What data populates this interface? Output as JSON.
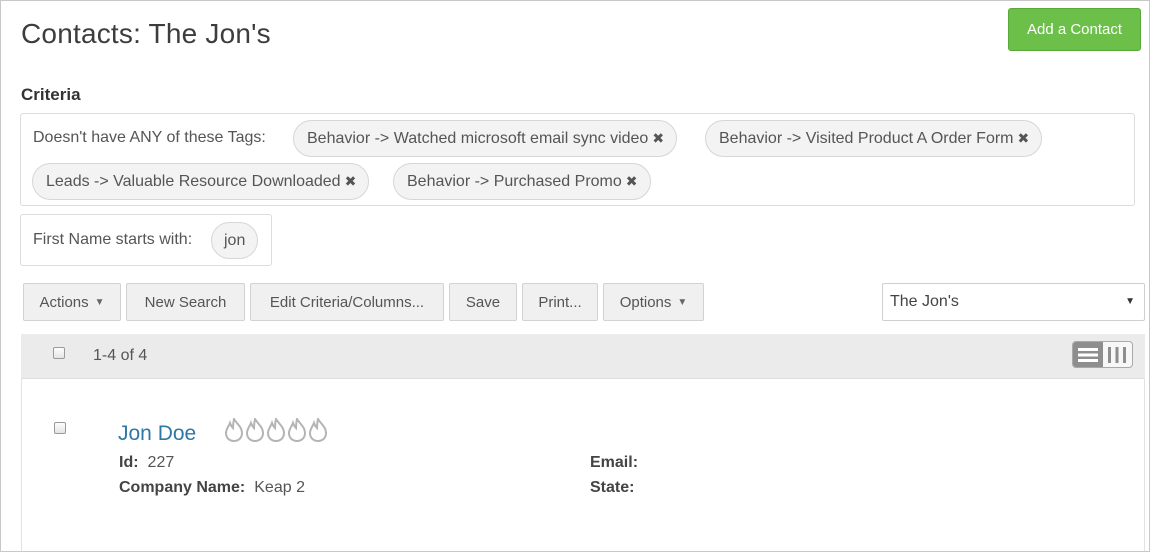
{
  "page": {
    "title": "Contacts: The Jon's"
  },
  "add_button": {
    "label": "Add a Contact"
  },
  "criteria": {
    "label": "Criteria",
    "tags_label": "Doesn't have ANY of these Tags:",
    "tags": [
      "Behavior -> Watched microsoft email sync video",
      "Behavior -> Visited Product A Order Form",
      "Leads -> Valuable Resource Downloaded",
      "Behavior -> Purchased Promo"
    ],
    "first_name_label": "First Name starts with:",
    "first_name_value": "jon"
  },
  "toolbar": {
    "actions": "Actions",
    "new_search": "New Search",
    "edit_criteria": "Edit Criteria/Columns...",
    "save": "Save",
    "print": "Print...",
    "options": "Options",
    "saved_search_selected": "The Jon's"
  },
  "list": {
    "count_text": "1-4 of 4",
    "contacts": [
      {
        "name": "Jon Doe",
        "id_label": "Id:",
        "id_value": "227",
        "company_label": "Company Name:",
        "company_value": "Keap 2",
        "email_label": "Email:",
        "state_label": "State:",
        "score_flames_total": 5,
        "score_flames_lit": 0
      }
    ]
  },
  "icons": {
    "remove_tag": "x-icon",
    "dropdown": "caret-down-icon",
    "list_view": "list-view-icon",
    "column_view": "column-view-icon",
    "score": "flame-icon"
  },
  "colors": {
    "primary_button": "#6cc04a",
    "link": "#2d78a6",
    "header_bg": "#ebebeb"
  }
}
